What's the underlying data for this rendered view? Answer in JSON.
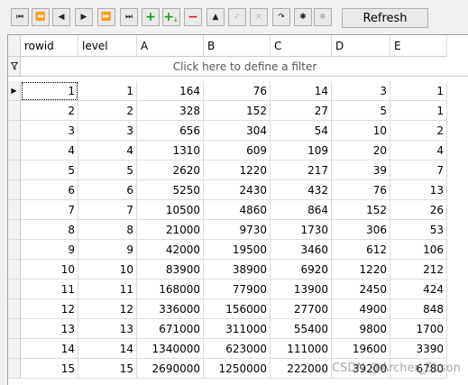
{
  "toolbar": {
    "buttons": [
      {
        "icon": "first-record-icon",
        "glyph": "⏮"
      },
      {
        "icon": "prior-page-icon",
        "glyph": "⏪"
      },
      {
        "icon": "prior-record-icon",
        "glyph": "◀"
      },
      {
        "icon": "next-record-icon",
        "glyph": "▶"
      },
      {
        "icon": "next-page-icon",
        "glyph": "⏩"
      },
      {
        "icon": "last-record-icon",
        "glyph": "⏭"
      },
      {
        "icon": "insert-icon",
        "glyph": "+"
      },
      {
        "icon": "append-icon",
        "glyph": "+"
      },
      {
        "icon": "delete-icon",
        "glyph": "−"
      },
      {
        "icon": "edit-icon",
        "glyph": "▲"
      },
      {
        "icon": "post-icon",
        "glyph": "✓"
      },
      {
        "icon": "cancel-icon",
        "glyph": "✕"
      },
      {
        "icon": "refresh-data-icon",
        "glyph": "↷"
      },
      {
        "icon": "save-bookmark-icon",
        "glyph": "✱"
      },
      {
        "icon": "goto-bookmark-icon",
        "glyph": "✱"
      }
    ],
    "refresh_label": "Refresh"
  },
  "grid": {
    "columns": [
      "rowid",
      "level",
      "A",
      "B",
      "C",
      "D",
      "E"
    ],
    "filter_text": "Click here to define a filter",
    "active_row_marker": "▶",
    "rows": [
      [
        "1",
        "1",
        "164",
        "76",
        "14",
        "3",
        "1"
      ],
      [
        "2",
        "2",
        "328",
        "152",
        "27",
        "5",
        "1"
      ],
      [
        "3",
        "3",
        "656",
        "304",
        "54",
        "10",
        "2"
      ],
      [
        "4",
        "4",
        "1310",
        "609",
        "109",
        "20",
        "4"
      ],
      [
        "5",
        "5",
        "2620",
        "1220",
        "217",
        "39",
        "7"
      ],
      [
        "6",
        "6",
        "5250",
        "2430",
        "432",
        "76",
        "13"
      ],
      [
        "7",
        "7",
        "10500",
        "4860",
        "864",
        "152",
        "26"
      ],
      [
        "8",
        "8",
        "21000",
        "9730",
        "1730",
        "306",
        "53"
      ],
      [
        "9",
        "9",
        "42000",
        "19500",
        "3460",
        "612",
        "106"
      ],
      [
        "10",
        "10",
        "83900",
        "38900",
        "6920",
        "1220",
        "212"
      ],
      [
        "11",
        "11",
        "168000",
        "77900",
        "13900",
        "2450",
        "424"
      ],
      [
        "12",
        "12",
        "336000",
        "156000",
        "27700",
        "4900",
        "848"
      ],
      [
        "13",
        "13",
        "671000",
        "311000",
        "55400",
        "9800",
        "1700"
      ],
      [
        "14",
        "14",
        "1340000",
        "623000",
        "111000",
        "19600",
        "3390"
      ],
      [
        "15",
        "15",
        "2690000",
        "1250000",
        "222000",
        "39200",
        "6780"
      ]
    ]
  },
  "watermark": "CSDN @Archer_Ebson"
}
